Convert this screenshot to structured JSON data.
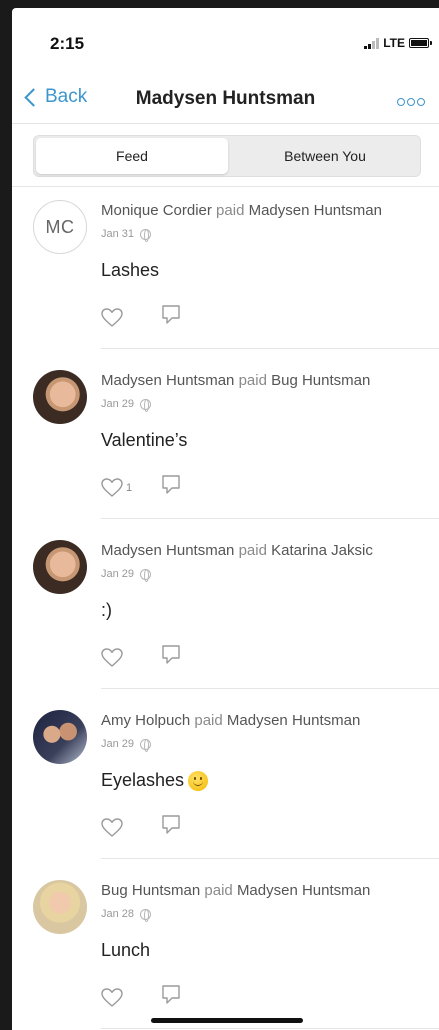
{
  "status_bar": {
    "time": "2:15",
    "network": "LTE"
  },
  "nav": {
    "back_label": "Back",
    "title": "Madysen Huntsman"
  },
  "tabs": [
    {
      "label": "Feed",
      "selected": true
    },
    {
      "label": "Between You",
      "selected": false
    }
  ],
  "colors": {
    "accent": "#3d95ce",
    "text": "#222222",
    "muted": "#8a8a8a"
  },
  "feed": [
    {
      "avatar_initials": "MC",
      "payer": "Monique Cordier",
      "verb": "paid",
      "payee": "Madysen Huntsman",
      "date": "Jan 31",
      "note": "Lashes",
      "like_count": ""
    },
    {
      "avatar_initials": "",
      "payer": "Madysen Huntsman",
      "verb": "paid",
      "payee": "Bug Huntsman",
      "date": "Jan 29",
      "note": "Valentine’s",
      "like_count": "1"
    },
    {
      "avatar_initials": "",
      "payer": "Madysen Huntsman",
      "verb": "paid",
      "payee": "Katarina Jaksic",
      "date": "Jan 29",
      "note": ":)",
      "like_count": ""
    },
    {
      "avatar_initials": "",
      "payer": "Amy Holpuch",
      "verb": "paid",
      "payee": "Madysen Huntsman",
      "date": "Jan 29",
      "note": "Eyelashes",
      "like_count": ""
    },
    {
      "avatar_initials": "",
      "payer": "Bug Huntsman",
      "verb": "paid",
      "payee": "Madysen Huntsman",
      "date": "Jan 28",
      "note": "Lunch",
      "like_count": ""
    }
  ]
}
